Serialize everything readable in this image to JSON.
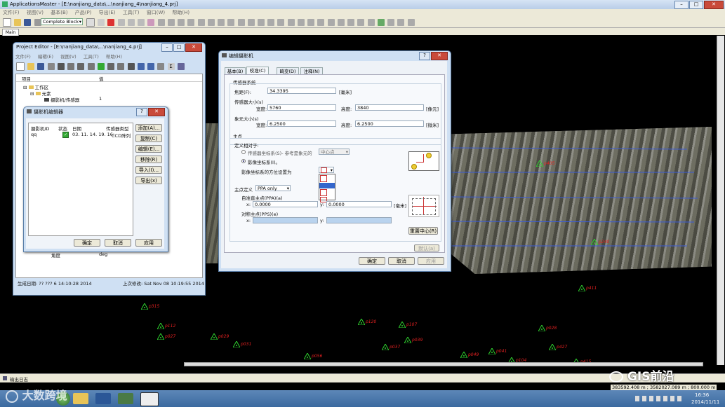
{
  "app": {
    "title": "ApplicationsMaster - [E:\\nanjiang_data\\...\\nanjiang_4\\nanjiang_4.prj]",
    "menu": [
      "文件(F)",
      "视图(V)",
      "基本(B)",
      "产品(P)",
      "导出(E)",
      "工具(T)",
      "窗口(W)",
      "帮助(H)"
    ],
    "block_select": "Complete Block",
    "tab": "Main",
    "output_label": "输出日志",
    "coords": "383592.408 m ; 3582027.089 m ; 800.000 m",
    "watermark_left": "大数跨境",
    "watermark_right": "GIS前沿",
    "clock_time": "16:36",
    "clock_date": "2014/11/11"
  },
  "project_editor": {
    "title": "Project Editor - [E:\\nanjiang_data\\...\\nanjiang_4.prj]",
    "menu": [
      "文件(F)",
      "编辑(E)",
      "视图(V)",
      "工具(T)",
      "帮助(H)"
    ],
    "col_item": "项目",
    "col_value": "值",
    "tree_root": "工作区",
    "tree_child": "元素",
    "tree_leaf": "摄影机/传感器",
    "tree_leaf_val": "1",
    "angle_label": "角度",
    "angle_val": "deg",
    "created": "生成日期: ?? ??? 6 14:10:28 2014",
    "modified": "上次修改: Sat Nov 08 10:19:55 2014"
  },
  "camera_manager": {
    "title": "摄影机编辑器",
    "headers": [
      "摄影机ID",
      "状态",
      "日期",
      "传感器类型"
    ],
    "row": {
      "id": "qq",
      "date": "03. 11. 14. 19. 16:",
      "type": "CCD阵列"
    },
    "side_buttons": [
      "添加(A)...",
      "复制(C)",
      "编辑(E)...",
      "移除(R)",
      "导入(I)...",
      "导出(x)"
    ],
    "ok": "确定",
    "cancel": "取消",
    "apply": "应用"
  },
  "camera_editor": {
    "title": "编辑摄影机",
    "tabs": [
      "基本(B)",
      "校准(C)",
      "畸变(D)",
      "注释(N)"
    ],
    "sensor_group": "传感器系统",
    "focal_label": "焦距(F):",
    "focal_value": "34.3395",
    "focal_unit": "[毫米]",
    "sensor_size_label": "传感器大小(s)",
    "width_label": "宽度:",
    "width_value": "5760",
    "height_label": "高度:",
    "height_value": "3840",
    "px_unit": "[像元]",
    "pixel_size_label": "象元大小(s)",
    "pw_label": "宽度:",
    "pw_value": "6.2500",
    "ph_label": "高度:",
    "ph_value": "6.2500",
    "um_unit": "[微米]",
    "principal_group": "主点",
    "defined_rel": "定义相对于:",
    "radio1": "传感器坐标系(S)- 参考是象元的",
    "radio1_select": "中心点",
    "radio2": "影像坐标系(I)。",
    "orient_label": "影像坐标系的方位设置为",
    "pp_def_label": "主点定义",
    "pp_def_value": "PPA only",
    "ppa_label": "自准直主点(PPA)(a)",
    "ppa_x_label": "x:",
    "ppa_x": "0.0000",
    "ppa_y_label": "y:",
    "ppa_y": "0.0000",
    "mm_unit": "[毫米]",
    "pps_label": "对称主点(PPS)(e)",
    "pps_x_label": "x:",
    "pps_y_label": "y:",
    "reset_center": "重置中心(R)",
    "default_btn": "默认(a)",
    "ok": "确定",
    "cancel": "取消",
    "apply": "应用"
  },
  "markers": [
    {
      "label": "p315"
    },
    {
      "label": "p112"
    },
    {
      "label": "p027"
    },
    {
      "label": "p029"
    },
    {
      "label": "p031"
    },
    {
      "label": "p120"
    },
    {
      "label": "p107"
    },
    {
      "label": "p037"
    },
    {
      "label": "p039"
    },
    {
      "label": "p056"
    },
    {
      "label": "p049"
    },
    {
      "label": "p041"
    },
    {
      "label": "p028"
    },
    {
      "label": "p427"
    },
    {
      "label": "p411"
    },
    {
      "label": "p104"
    },
    {
      "label": "p415"
    },
    {
      "label": "p405"
    },
    {
      "label": "p240"
    }
  ]
}
